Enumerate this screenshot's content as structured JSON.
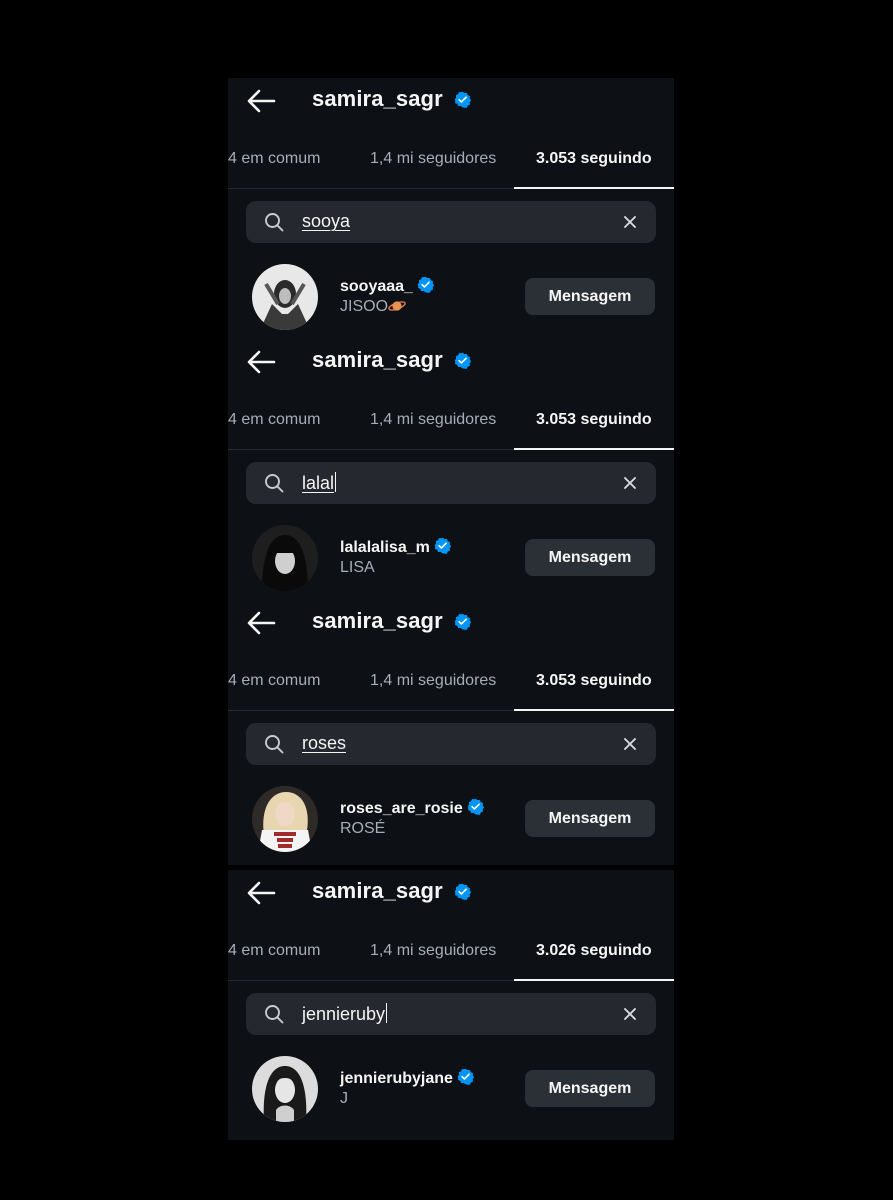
{
  "colors": {
    "background": "#000000",
    "panel": "#0d1014",
    "search_bg": "#25282e",
    "button_bg": "#2b2f36",
    "text_primary": "#f5f5f5",
    "text_secondary": "#a8adb5",
    "verified_blue": "#0095f6"
  },
  "icons": {
    "back": "arrow-left-icon",
    "verified": "verified-badge-icon",
    "search": "search-icon",
    "clear": "close-icon",
    "planet": "ringed-planet-emoji"
  },
  "panels": [
    {
      "header": {
        "username": "samira_sagr"
      },
      "tabs": {
        "mutual": "4 em comum",
        "followers": "1,4 mi seguidores",
        "following": "3.053 seguindo"
      },
      "search": {
        "value": "sooya"
      },
      "result": {
        "username": "sooyaaa_",
        "full_name": "JISOO",
        "button_label": "Mensagem"
      }
    },
    {
      "header": {
        "username": "samira_sagr"
      },
      "tabs": {
        "mutual": "4 em comum",
        "followers": "1,4 mi seguidores",
        "following": "3.053 seguindo"
      },
      "search": {
        "value": "lalal"
      },
      "result": {
        "username": "lalalalisa_m",
        "full_name": "LISA",
        "button_label": "Mensagem"
      }
    },
    {
      "header": {
        "username": "samira_sagr"
      },
      "tabs": {
        "mutual": "4 em comum",
        "followers": "1,4 mi seguidores",
        "following": "3.053 seguindo"
      },
      "search": {
        "value": "roses"
      },
      "result": {
        "username": "roses_are_rosie",
        "full_name": "ROSÉ",
        "button_label": "Mensagem"
      }
    },
    {
      "header": {
        "username": "samira_sagr"
      },
      "tabs": {
        "mutual": "4 em comum",
        "followers": "1,4 mi seguidores",
        "following": "3.026 seguindo"
      },
      "search": {
        "value": "jennieruby"
      },
      "result": {
        "username": "jennierubyjane",
        "full_name": "J",
        "button_label": "Mensagem"
      }
    }
  ]
}
